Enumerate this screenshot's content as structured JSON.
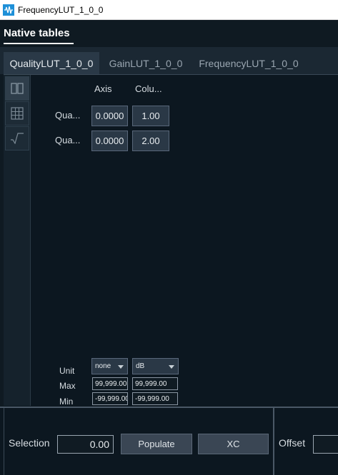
{
  "window": {
    "title": "FrequencyLUT_1_0_0"
  },
  "header": {
    "title": "Native tables"
  },
  "tabs": [
    {
      "label": "QualityLUT_1_0_0"
    },
    {
      "label": "GainLUT_1_0_0"
    },
    {
      "label": "FrequencyLUT_1_0_0"
    }
  ],
  "table": {
    "columns": [
      "Axis",
      "Colu..."
    ],
    "rows": [
      {
        "label": "Qua...",
        "axis": "0.0000",
        "value": "1.00"
      },
      {
        "label": "Qua...",
        "axis": "0.0000",
        "value": "2.00"
      }
    ]
  },
  "props": {
    "unit_label": "Unit",
    "max_label": "Max",
    "min_label": "Min",
    "axis_unit": "none",
    "col_unit": "dB",
    "axis_max": "99,999.00",
    "col_max": "99,999.00",
    "axis_min": "-99,999.00",
    "col_min": "-99,999.00"
  },
  "bottom": {
    "selection_label": "Selection",
    "selection_value": "0.00",
    "populate_label": "Populate",
    "xc_label": "XC",
    "offset_label": "Offset"
  },
  "icons": {
    "app": "waveform-icon",
    "side_1": "columns-icon",
    "side_2": "grid-icon",
    "side_3": "sqrt-icon"
  },
  "colors": {
    "background": "#0f1a22",
    "panel": "#0c1720",
    "cell": "#2a3846",
    "button": "#3a4654",
    "accent_icon": "#1e90d8"
  }
}
